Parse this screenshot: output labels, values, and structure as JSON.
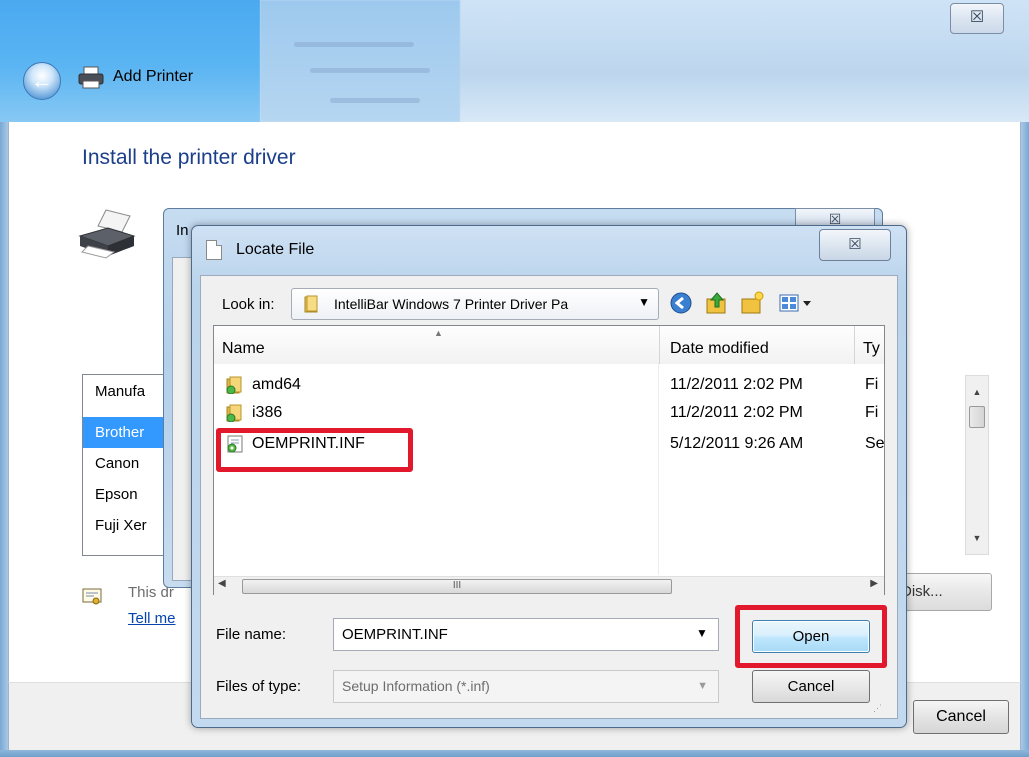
{
  "wizard": {
    "title": "Add Printer",
    "heading": "Install the printer driver",
    "close_glyph": "☒",
    "back_glyph": "←",
    "manufacturer_header": "Manufa",
    "manufacturers": [
      "Brother",
      "Canon",
      "Epson",
      "Fuji Xer"
    ],
    "cert_text": "This dr",
    "tell_link": "Tell me",
    "have_disk": "Disk...",
    "cancel": "Cancel"
  },
  "install_dialog": {
    "title": "In",
    "close_glyph": "☒"
  },
  "locate_file": {
    "title": "Locate File",
    "close_glyph": "☒",
    "look_in_label": "Look in:",
    "look_in_value": "IntelliBar Windows 7 Printer Driver Pa",
    "columns": {
      "name": "Name",
      "date": "Date modified",
      "type": "Ty"
    },
    "files": [
      {
        "name": "amd64",
        "date": "11/2/2011 2:02 PM",
        "type": "Fi",
        "icon": "folder-icon"
      },
      {
        "name": "i386",
        "date": "11/2/2011 2:02 PM",
        "type": "Fi",
        "icon": "folder-icon"
      },
      {
        "name": "OEMPRINT.INF",
        "date": "5/12/2011 9:26 AM",
        "type": "Se",
        "icon": "inf-file-icon"
      }
    ],
    "scroll_grip": "III",
    "file_name_label": "File name:",
    "file_name_value": "OEMPRINT.INF",
    "file_type_label": "Files of type:",
    "file_type_value": "Setup Information (*.inf)",
    "open_label": "Open",
    "cancel_label": "Cancel"
  },
  "colors": {
    "highlight": "#e2182c",
    "heading_blue": "#1b3f8b",
    "selection": "#3399ff"
  }
}
